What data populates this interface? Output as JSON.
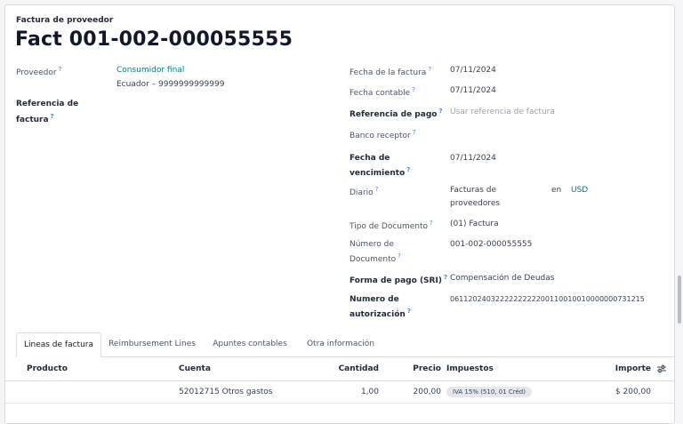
{
  "header": {
    "eyebrow": "Factura de proveedor",
    "title": "Fact 001-002-000055555"
  },
  "left_fields": {
    "proveedor_label": "Proveedor",
    "proveedor_name": "Consumidor final",
    "proveedor_detail": "Ecuador – 9999999999999",
    "referencia_label_1": "Referencia de",
    "referencia_label_2": "factura"
  },
  "right_fields": {
    "fecha_factura_label": "Fecha de la factura",
    "fecha_factura": "07/11/2024",
    "fecha_contable_label": "Fecha contable",
    "fecha_contable": "07/11/2024",
    "ref_pago_label": "Referencia de pago",
    "ref_pago_placeholder": "Usar referencia de factura",
    "banco_label": "Banco receptor",
    "vencimiento_label_1": "Fecha de",
    "vencimiento_label_2": "vencimiento",
    "vencimiento": "07/11/2024",
    "diario_label": "Diario",
    "diario_value_1": "Facturas de",
    "diario_value_2": "proveedores",
    "diario_en": "en",
    "diario_currency": "USD",
    "tipo_doc_label": "Tipo de Documento",
    "tipo_doc": "(01) Factura",
    "num_doc_label_1": "Número de",
    "num_doc_label_2": "Documento",
    "num_doc": "001-002-000055555",
    "forma_pago_label": "Forma de pago (SRI)",
    "forma_pago": "Compensación de Deudas",
    "num_aut_label_1": "Numero de",
    "num_aut_label_2": "autorización",
    "num_aut": "0611202403222222222200110010010000000731215"
  },
  "help_mark": "?",
  "tabs": [
    {
      "label": "Lineas de factura"
    },
    {
      "label": "Reimbursement Lines"
    },
    {
      "label": "Apuntes contables"
    },
    {
      "label": "Otra información"
    }
  ],
  "table": {
    "headers": {
      "producto": "Producto",
      "cuenta": "Cuenta",
      "cantidad": "Cantidad",
      "precio": "Precio",
      "impuestos": "Impuestos",
      "importe": "Importe"
    },
    "rows": [
      {
        "producto": "",
        "cuenta": "52012715 Otros gastos",
        "cantidad": "1,00",
        "precio": "200,00",
        "impuesto": "IVA 15% (510, 01 Créd)",
        "importe": "$ 200,00"
      }
    ]
  },
  "icons": {
    "columns_toggle": "sliders-icon"
  }
}
